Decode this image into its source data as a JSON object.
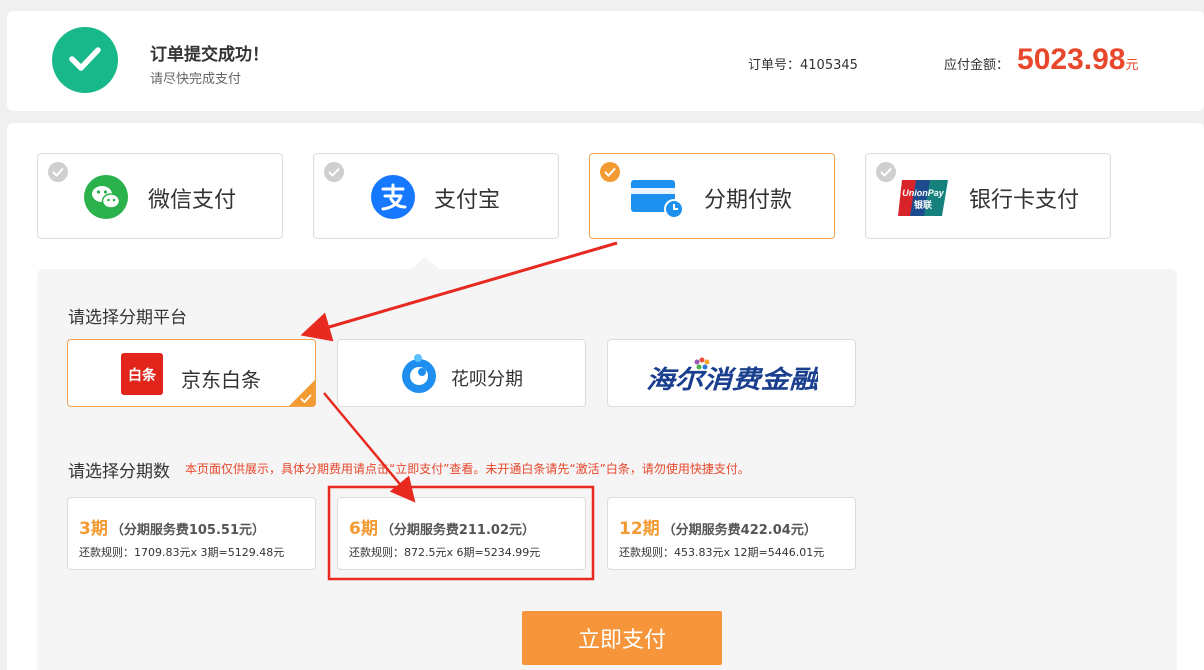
{
  "header": {
    "title": "订单提交成功！",
    "subtitle": "请尽快完成支付",
    "order_label": "订单号：",
    "order_no": "4105345",
    "amount_label": "应付金额：",
    "amount": "5023.98",
    "amount_unit": "元"
  },
  "payment_methods": [
    {
      "label": "微信支付",
      "icon": "wechat-icon",
      "selected": false
    },
    {
      "label": "支付宝",
      "icon": "alipay-icon",
      "selected": false
    },
    {
      "label": "分期付款",
      "icon": "card-clock-icon",
      "selected": true
    },
    {
      "label": "银行卡支付",
      "icon": "unionpay-icon",
      "selected": false
    }
  ],
  "platform_section": {
    "title": "请选择分期平台",
    "platforms": [
      {
        "label": "京东白条",
        "logo_text": "白条",
        "selected": true
      },
      {
        "label": "花呗分期",
        "selected": false
      },
      {
        "label": "海尔消费金融",
        "logo_text": "海尔消费金融",
        "selected": false
      }
    ]
  },
  "plan_section": {
    "title": "请选择分期数",
    "note": "本页面仅供展示，具体分期费用请点击“立即支付”查看。未开通白条请先“激活”白条，请勿使用快捷支付。",
    "plans": [
      {
        "period": "3期",
        "fee": "（分期服务费105.51元）",
        "rule": "还款规则：1709.83元x 3期=5129.48元"
      },
      {
        "period": "6期",
        "fee": "（分期服务费211.02元）",
        "rule": "还款规则：872.5元x 6期=5234.99元"
      },
      {
        "period": "12期",
        "fee": "（分期服务费422.04元）",
        "rule": "还款规则：453.83元x 12期=5446.01元"
      }
    ]
  },
  "pay_button_label": "立即支付",
  "colors": {
    "success": "#19b88a",
    "accent": "#f39a32",
    "price": "#e8472b",
    "annotation": "#e8291f"
  }
}
